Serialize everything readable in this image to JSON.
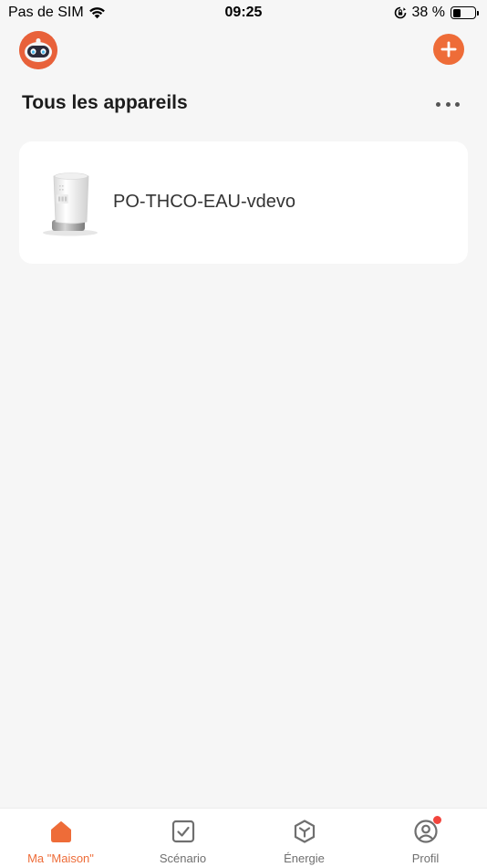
{
  "status_bar": {
    "carrier": "Pas de SIM",
    "time": "09:25",
    "battery_percent": "38 %",
    "battery_level": 0.38
  },
  "header": {
    "section_title": "Tous les appareils"
  },
  "devices": [
    {
      "name": "PO-THCO-EAU-vdevo",
      "icon": "thermostatic-valve-image"
    }
  ],
  "tab_bar": {
    "tabs": [
      {
        "label": "Ma \"Maison\"",
        "icon": "home-icon",
        "active": true
      },
      {
        "label": "Scénario",
        "icon": "checkbox-icon",
        "active": false
      },
      {
        "label": "Énergie",
        "icon": "energy-hexagon-icon",
        "active": false
      },
      {
        "label": "Profil",
        "icon": "profile-icon",
        "active": false,
        "notification_dot": true
      }
    ]
  },
  "colors": {
    "accent": "#ee6c38",
    "background": "#f6f6f6",
    "card": "#ffffff",
    "notification": "#f2453d"
  }
}
